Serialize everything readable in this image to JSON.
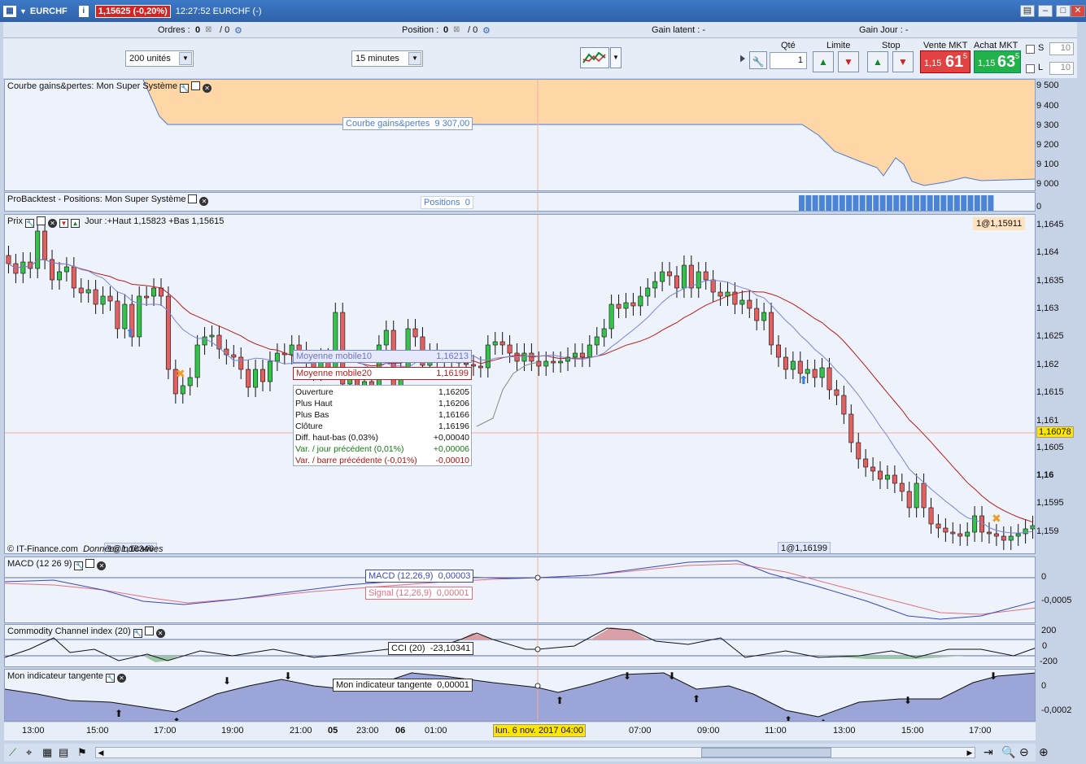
{
  "window": {
    "symbol": "EURCHF",
    "price_badge": "1,15625 (-0,20%)",
    "time_label": "12:27:52 EURCHF (-)",
    "buttons": [
      "▤",
      "–",
      "□",
      "✕"
    ]
  },
  "orderbar": {
    "ordres_label": "Ordres :",
    "ordres_a": "0",
    "ordres_b": "/ 0",
    "position_label": "Position :",
    "position_a": "0",
    "position_b": "/ 0",
    "gain_latent": "Gain latent : -",
    "gain_jour": "Gain Jour : -"
  },
  "toolbar": {
    "qty_units": "200 unités",
    "timeframe": "15 minutes",
    "qte_label": "Qté",
    "qte_value": "1",
    "limite_label": "Limite",
    "stop_label": "Stop",
    "vente_label": "Vente MKT",
    "achat_label": "Achat MKT",
    "vente_small": "1,15",
    "vente_big": "61",
    "vente_sup": "5",
    "achat_small": "1,15",
    "achat_big": "63",
    "achat_sup": "5",
    "s_label": "S",
    "l_label": "L",
    "s_value": "10",
    "l_value": "10"
  },
  "panels": {
    "courbe": {
      "title": "Courbe gains&pertes: Mon Super Système",
      "label": "Courbe gains&pertes",
      "value": "9 307,00",
      "axis": [
        "9 500",
        "9 400",
        "9 300",
        "9 200",
        "9 100",
        "9 000"
      ]
    },
    "positions": {
      "title": "ProBacktest - Positions: Mon Super Système",
      "label": "Positions",
      "value": "0",
      "axis": [
        "0"
      ]
    },
    "prix": {
      "title": "Prix",
      "header": "Jour :+Haut 1,15823 +Bas 1,15615",
      "badge_right": "1@1,15911",
      "badge_left": "1@1,16346",
      "badge_mid": "1@1,16199",
      "copyright": "© IT-Finance.com",
      "copyright2": "Données indicatives",
      "mm10_label": "Moyenne mobile10",
      "mm10_value": "1,16213",
      "mm20_label": "Moyenne mobile20",
      "mm20_value": "1,16199",
      "current_price": "1,16078",
      "axis": [
        "1,1645",
        "1,164",
        "1,1635",
        "1,163",
        "1,1625",
        "1,162",
        "1,1615",
        "1,161",
        "1,1605",
        "1,16",
        "1,1595",
        "1,159"
      ]
    },
    "macd": {
      "title": "MACD (12 26 9)",
      "macd_label": "MACD (12,26,9)",
      "macd_value": "0,00003",
      "signal_label": "Signal (12,26,9)",
      "signal_value": "0,00001",
      "axis": [
        "0",
        "-0,0005"
      ]
    },
    "cci": {
      "title": "Commodity Channel index (20)",
      "label": "CCI (20)",
      "value": "-23,10341",
      "axis": [
        "200",
        "0",
        "-200"
      ]
    },
    "tangente": {
      "title": "Mon  indicateur tangente",
      "label": "Mon  indicateur tangente",
      "value": "0,00001",
      "axis": [
        "0",
        "-0,0002"
      ]
    }
  },
  "info_box": [
    {
      "k": "Ouverture",
      "v": "1,16205",
      "c": "#111"
    },
    {
      "k": "Plus Haut",
      "v": "1,16206",
      "c": "#111"
    },
    {
      "k": "Plus Bas",
      "v": "1,16166",
      "c": "#111"
    },
    {
      "k": "Clôture",
      "v": "1,16196",
      "c": "#111"
    },
    {
      "k": "Diff. haut-bas (0,03%)",
      "v": "+0,00040",
      "c": "#111"
    },
    {
      "k": "Var. / jour précédent (0,01%)",
      "v": "+0,00006",
      "c": "#137a13"
    },
    {
      "k": "Var. / barre précédente (-0,01%)",
      "v": "-0,00010",
      "c": "#b01010"
    }
  ],
  "timeaxis": {
    "labels": [
      "13:00",
      "15:00",
      "17:00",
      "19:00",
      "21:00",
      "05",
      "23:00",
      "06",
      "01:00",
      "07:00",
      "09:00",
      "11:00",
      "13:00",
      "15:00",
      "17:00"
    ],
    "cursor_date": "lun. 6 nov. 2017 04:00"
  },
  "colors": {
    "up": "#33c24a",
    "down": "#e26060",
    "mm10": "#7b86d6",
    "mm20": "#b51e1e",
    "equity": "#ffd7a6"
  }
}
